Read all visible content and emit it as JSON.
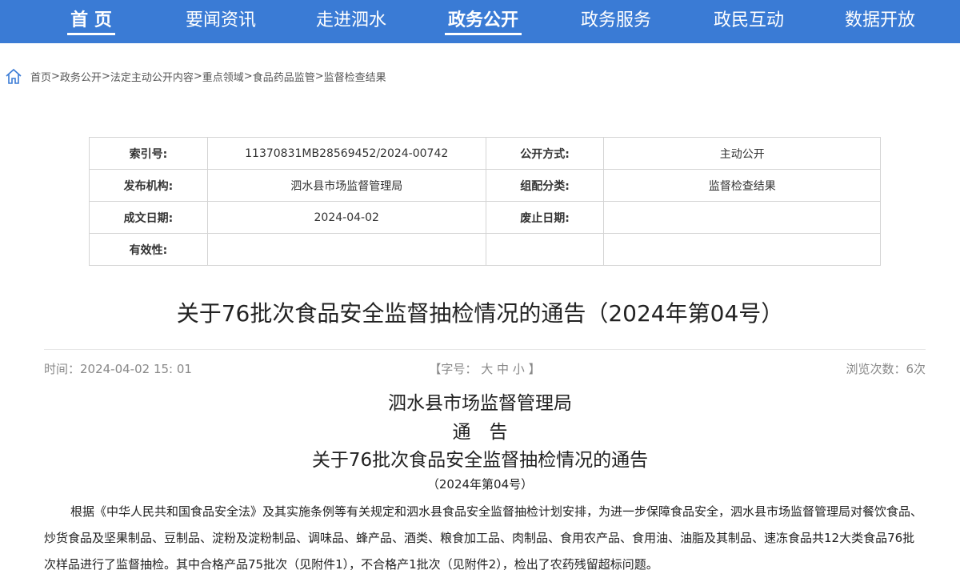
{
  "nav": {
    "items": [
      {
        "label": "首 页"
      },
      {
        "label": "要闻资讯"
      },
      {
        "label": "走进泗水"
      },
      {
        "label": "政务公开"
      },
      {
        "label": "政务服务"
      },
      {
        "label": "政民互动"
      },
      {
        "label": "数据开放"
      }
    ]
  },
  "breadcrumb": {
    "items": [
      "首页",
      "政务公开",
      "法定主动公开内容",
      "重点领域",
      "食品药品监管",
      "监督检查结果"
    ],
    "separator": ">"
  },
  "meta": {
    "index_label": "索引号:",
    "index_value": "11370831MB28569452/2024-00742",
    "open_method_label": "公开方式:",
    "open_method_value": "主动公开",
    "publisher_label": "发布机构:",
    "publisher_value": "泗水县市场监督管理局",
    "category_label": "组配分类:",
    "category_value": "监督检查结果",
    "date_label": "成文日期:",
    "date_value": "2024-04-02",
    "abolish_label": "废止日期:",
    "abolish_value": "",
    "validity_label": "有效性:",
    "validity_value": ""
  },
  "article": {
    "title": "关于76批次食品安全监督抽检情况的通告（2024年第04号）",
    "time": "时间：2024-04-02 15: 01",
    "fontsize_prefix": "【字号：",
    "fontsize_large": "大",
    "fontsize_medium": "中",
    "fontsize_small": "小",
    "fontsize_suffix": "】",
    "views": "浏览次数：6次",
    "org": "泗水县市场监督管理局",
    "notice": "通　告",
    "subtitle": "关于76批次食品安全监督抽检情况的通告",
    "number": "（2024年第04号）",
    "paragraph": "根据《中华人民共和国食品安全法》及其实施条例等有关规定和泗水县食品安全监督抽检计划安排，为进一步保障食品安全，泗水县市场监督管理局对餐饮食品、炒货食品及坚果制品、豆制品、淀粉及淀粉制品、调味品、蜂产品、酒类、粮食加工品、肉制品、食用农产品、食用油、油脂及其制品、速冻食品共12大类食品76批次样品进行了监督抽检。其中合格产品75批次（见附件1），不合格产1批次（见附件2），检出了农药残留超标问题。"
  },
  "colors": {
    "nav_bg": "#3a7bd5",
    "nav_text": "#ffffff"
  }
}
